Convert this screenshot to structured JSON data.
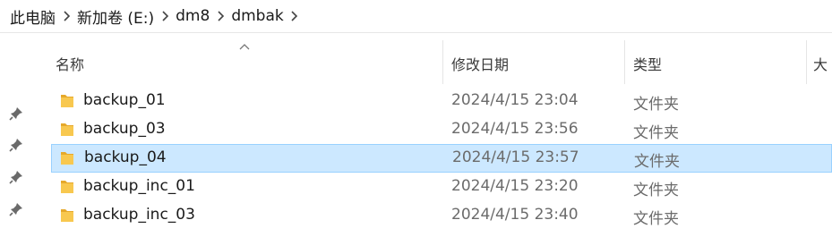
{
  "breadcrumb": {
    "items": [
      "此电脑",
      "新加卷 (E:)",
      "dm8",
      "dmbak"
    ]
  },
  "columns": {
    "name": "名称",
    "modified": "修改日期",
    "type": "类型",
    "size": "大"
  },
  "sort": {
    "column": "name",
    "direction": "ascending"
  },
  "files": [
    {
      "name": "backup_01",
      "modified": "2024/4/15 23:04",
      "type": "文件夹",
      "selected": false
    },
    {
      "name": "backup_03",
      "modified": "2024/4/15 23:56",
      "type": "文件夹",
      "selected": false
    },
    {
      "name": "backup_04",
      "modified": "2024/4/15 23:57",
      "type": "文件夹",
      "selected": true
    },
    {
      "name": "backup_inc_01",
      "modified": "2024/4/15 23:20",
      "type": "文件夹",
      "selected": false
    },
    {
      "name": "backup_inc_03",
      "modified": "2024/4/15 23:40",
      "type": "文件夹",
      "selected": false
    }
  ],
  "icons": {
    "folder": "folder-icon",
    "pin": "pin-icon",
    "separator": "chevron-right-icon",
    "sort": "sort-up-caret-icon"
  },
  "colors": {
    "selection_fill": "#cce8ff",
    "selection_border": "#99d1ff",
    "folder": "#f8c84f",
    "folder_dark": "#e6a92b"
  }
}
